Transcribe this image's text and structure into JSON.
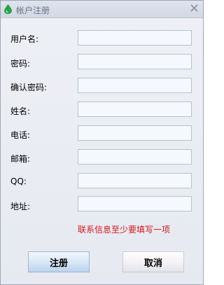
{
  "window": {
    "title": "帐户注册",
    "close_glyph": "✕"
  },
  "fields": [
    {
      "label": "用户名:",
      "value": ""
    },
    {
      "label": "密码:",
      "value": ""
    },
    {
      "label": "确认密码:",
      "value": ""
    },
    {
      "label": "姓名:",
      "value": ""
    },
    {
      "label": "电话:",
      "value": ""
    },
    {
      "label": "邮箱:",
      "value": ""
    },
    {
      "label": "QQ:",
      "value": ""
    },
    {
      "label": "地址:",
      "value": ""
    }
  ],
  "notice": "联系信息至少要填写一项",
  "buttons": {
    "register_label": "注册",
    "cancel_label": "取消"
  },
  "colors": {
    "notice": "#d01818",
    "app_icon": "#2aa04a"
  },
  "icons": {
    "app": "green-drop-icon",
    "close": "close-icon"
  }
}
